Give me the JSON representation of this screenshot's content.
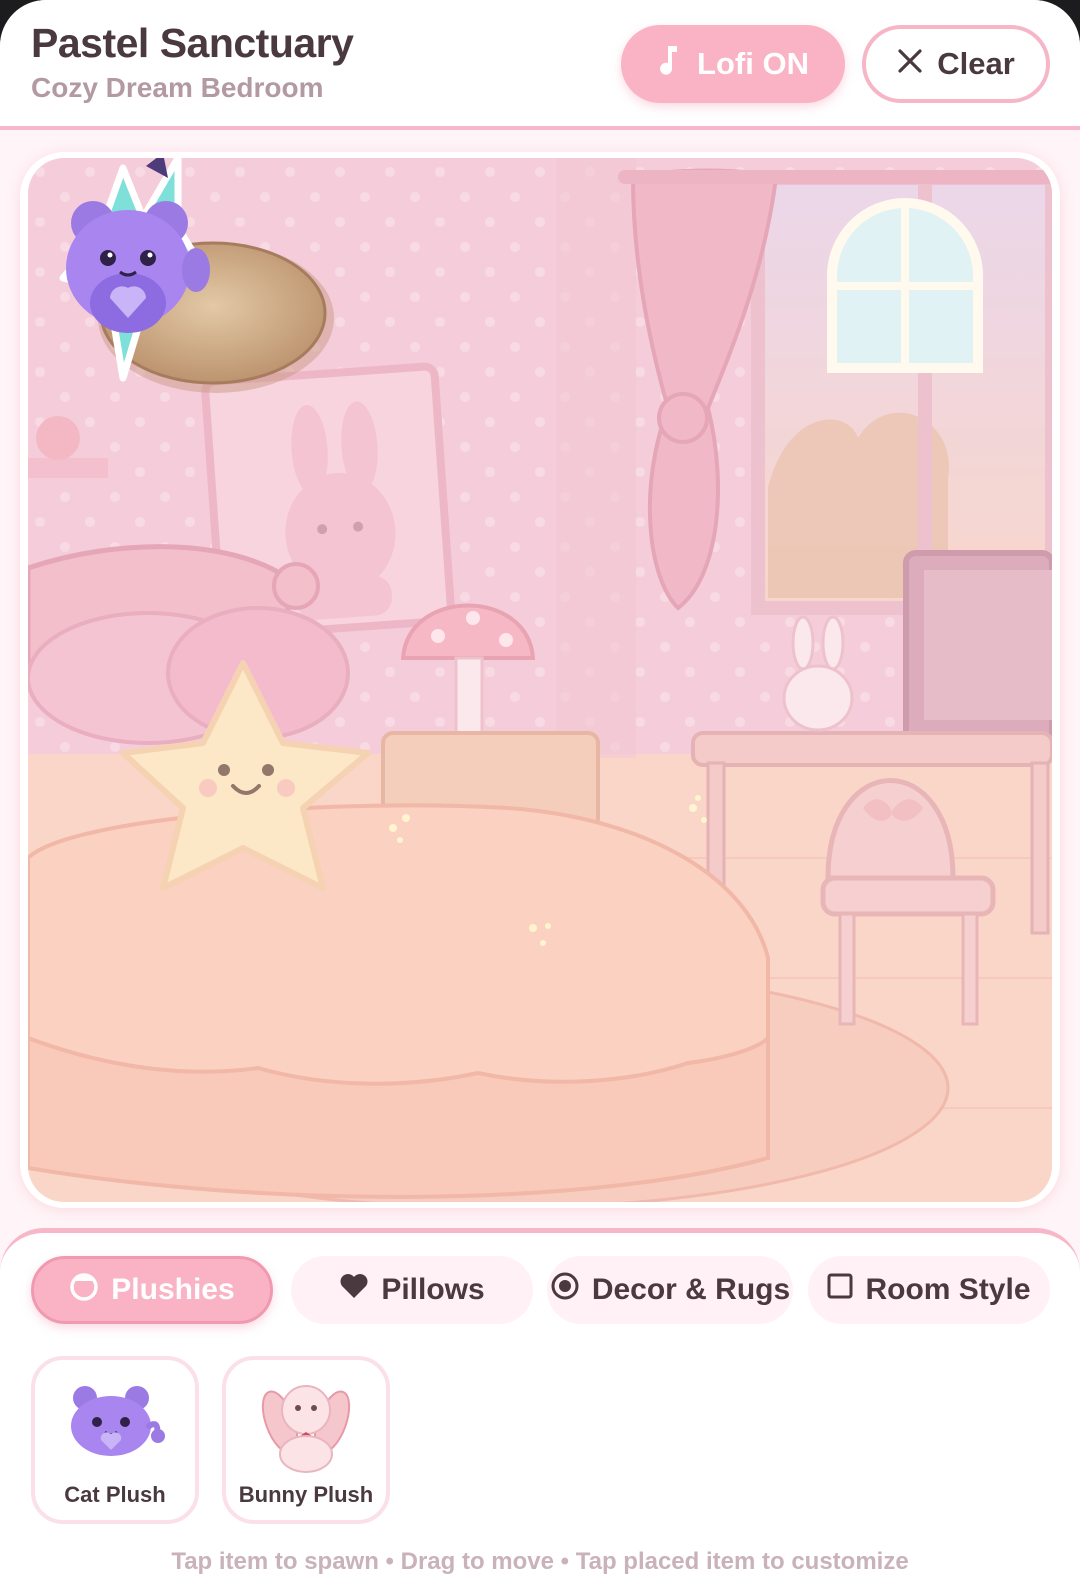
{
  "header": {
    "title": "Pastel Sanctuary",
    "subtitle": "Cozy Dream Bedroom",
    "lofi_button": {
      "label": "Lofi ON",
      "icon": "music-note-icon",
      "active": true
    },
    "clear_button": {
      "label": "Clear",
      "icon": "close-icon"
    }
  },
  "tabs": [
    {
      "label": "Plushies",
      "icon": "plush-icon",
      "active": true
    },
    {
      "label": "Pillows",
      "icon": "heart-icon",
      "active": false
    },
    {
      "label": "Decor & Rugs",
      "icon": "radio-dot-icon",
      "active": false
    },
    {
      "label": "Room Style",
      "icon": "square-icon",
      "active": false
    }
  ],
  "items": [
    {
      "label": "Cat Plush",
      "icon": "cat-plush-icon"
    },
    {
      "label": "Bunny Plush",
      "icon": "bunny-plush-icon"
    }
  ],
  "hint": "Tap item to spawn • Drag to move • Tap placed item to customize",
  "colors": {
    "accent_pink": "#f9b3c4",
    "border_pink": "#f8b7c8",
    "text_dark": "#4a3a40",
    "text_muted": "#b39aa2",
    "room_wall": "#f3c3d2",
    "room_floor": "#f9cdbe"
  },
  "placed_items": [
    {
      "name": "star-pillow-teal",
      "icon": "star-pillow-icon"
    },
    {
      "name": "cat-plush",
      "icon": "cat-plush-icon"
    },
    {
      "name": "round-fluffy-rug",
      "icon": "rug-icon"
    }
  ]
}
